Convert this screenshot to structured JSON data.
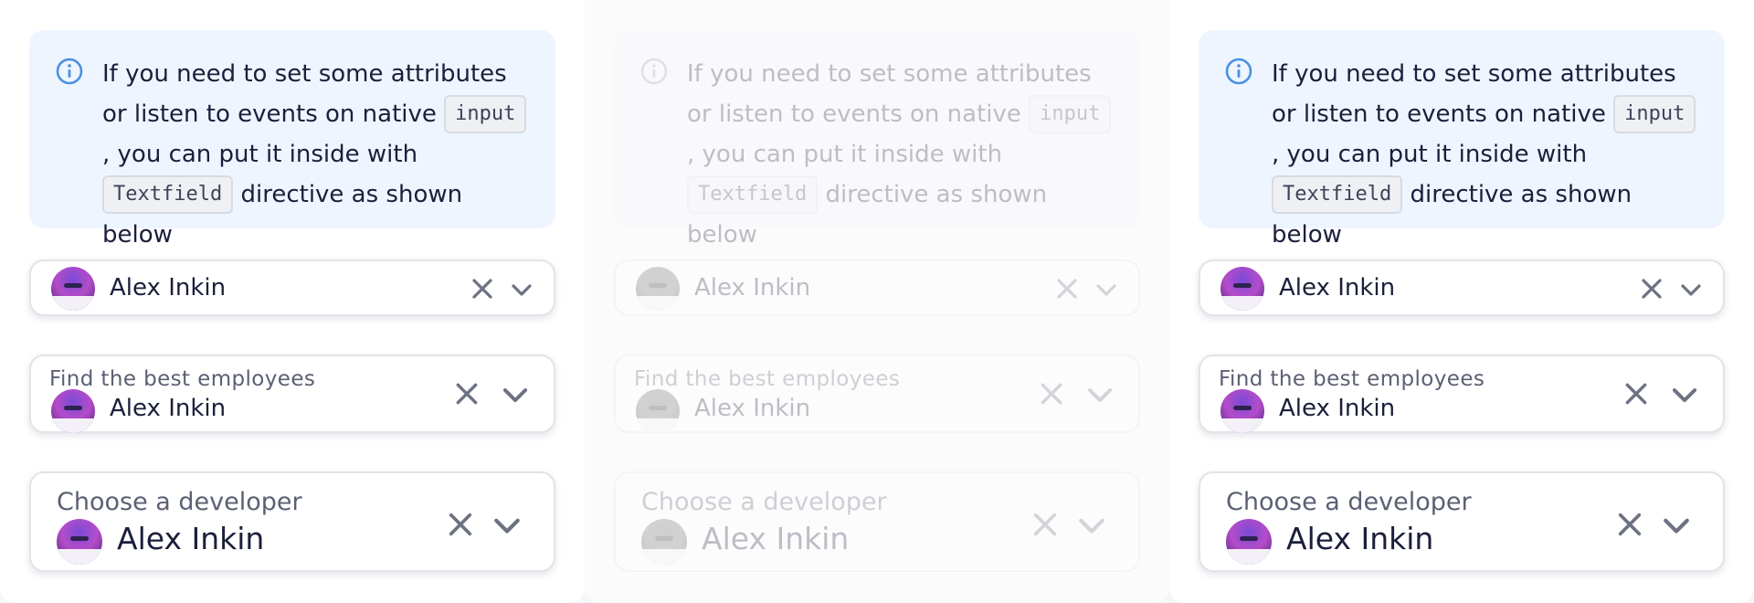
{
  "notice": {
    "part1": "If you need to set some attributes or listen to events on native ",
    "code_input": "input",
    "part2": ", you can put it inside with ",
    "code_textfield": "Textfield",
    "part3": " directive as shown below"
  },
  "fields": {
    "simple": {
      "value": "Alex Inkin"
    },
    "labeled": {
      "label": "Find the best employees",
      "value": "Alex Inkin"
    },
    "large": {
      "label": "Choose a developer",
      "value": "Alex Inkin"
    }
  },
  "icons": {
    "info": "info-icon",
    "clear": "close-icon",
    "dropdown": "chevron-down-icon"
  },
  "colors": {
    "notice_background": "#eef5ff",
    "info_icon": "#4a90e2",
    "text": "#1b1f3b",
    "label": "#5b6073",
    "icon_gray": "#6d7282"
  }
}
